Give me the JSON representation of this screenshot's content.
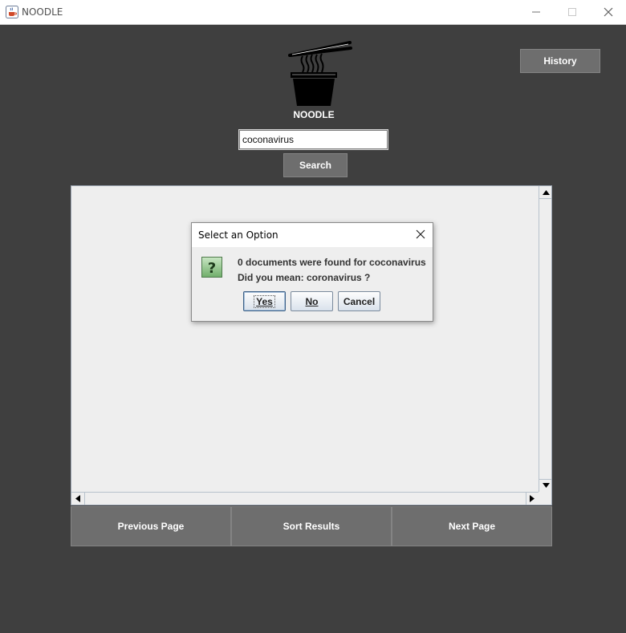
{
  "window": {
    "title": "NOODLE",
    "icon": "java-cup-icon"
  },
  "logo": {
    "text": "NOODLE",
    "icon": "noodle-bowl-icon"
  },
  "history_button": "History",
  "search": {
    "value": "coconavirus",
    "button": "Search"
  },
  "nav": {
    "previous": "Previous Page",
    "sort": "Sort Results",
    "next": "Next Page"
  },
  "dialog": {
    "title": "Select an Option",
    "line1": "0 documents were found for coconavirus",
    "line2": "Did you mean: coronavirus ?",
    "buttons": {
      "yes": "Yes",
      "no": "No",
      "cancel": "Cancel"
    }
  },
  "colors": {
    "background": "#3f3f3f",
    "button": "#6e6e6e",
    "panel": "#eeeeee"
  }
}
